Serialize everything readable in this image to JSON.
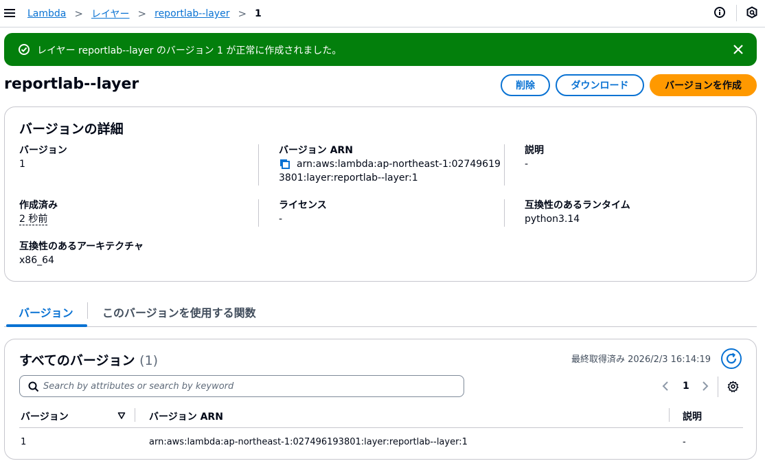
{
  "breadcrumb": {
    "items": [
      "Lambda",
      "レイヤー",
      "reportlab--layer"
    ],
    "current": "1"
  },
  "flash": {
    "message": "レイヤー reportlab--layer のバージョン 1 が正常に作成されました。",
    "color": "#037f0c"
  },
  "page": {
    "title": "reportlab--layer",
    "buttons": {
      "delete": "削除",
      "download": "ダウンロード",
      "create_version": "バージョンを作成"
    }
  },
  "details": {
    "title": "バージョンの詳細",
    "version_label": "バージョン",
    "version_value": "1",
    "arn_label": "バージョン ARN",
    "arn_line1": "arn:aws:lambda:ap-northeast-1:02749619",
    "arn_line2": "3801:layer:reportlab--layer:1",
    "description_label": "説明",
    "description_value": "-",
    "created_label": "作成済み",
    "created_value": "2 秒前",
    "license_label": "ライセンス",
    "license_value": "-",
    "runtime_label": "互換性のあるランタイム",
    "runtime_value": "python3.14",
    "arch_label": "互換性のあるアーキテクチャ",
    "arch_value": "x86_64"
  },
  "tabs": [
    "バージョン",
    "このバージョンを使用する関数"
  ],
  "versions": {
    "title": "すべてのバージョン",
    "count": "(1)",
    "last_fetched": "最終取得済み 2026/2/3 16:14:19",
    "search_placeholder": "Search by attributes or search by keyword",
    "page_number": "1",
    "columns": [
      "バージョン",
      "バージョン ARN",
      "説明"
    ],
    "rows": [
      {
        "version": "1",
        "arn": "arn:aws:lambda:ap-northeast-1:027496193801:layer:reportlab--layer:1",
        "description": "-"
      }
    ]
  },
  "colors": {
    "accent": "#0972d3",
    "primary_button": "#ff9900",
    "success": "#037f0c"
  }
}
